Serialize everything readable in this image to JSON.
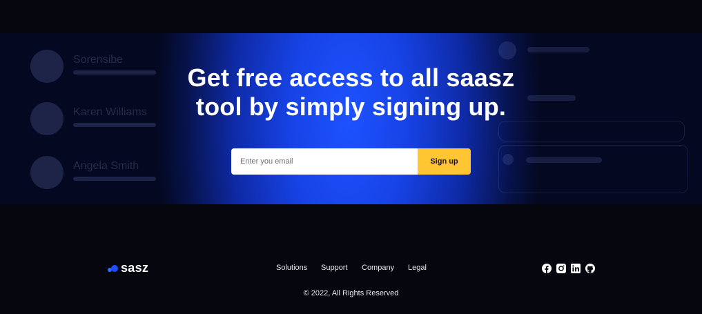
{
  "cta": {
    "headline_line1": "Get free access to all saasz",
    "headline_line2": "tool by simply signing up.",
    "email_placeholder": "Enter you email",
    "signup_label": "Sign up",
    "background_names": [
      "Sorensibe",
      "Karen Williams",
      "Angela Smith"
    ]
  },
  "footer": {
    "logo_text": "sasz",
    "nav": [
      "Solutions",
      "Support",
      "Company",
      "Legal"
    ],
    "socials": [
      "facebook-icon",
      "instagram-icon",
      "linkedin-icon",
      "github-icon"
    ],
    "copyright": "© 2022, All Rights Reserved"
  },
  "colors": {
    "background": "#06060f",
    "cta_blue": "#1d52ff",
    "signup_yellow": "#ffc533",
    "logo_blue": "#2d6bff"
  }
}
